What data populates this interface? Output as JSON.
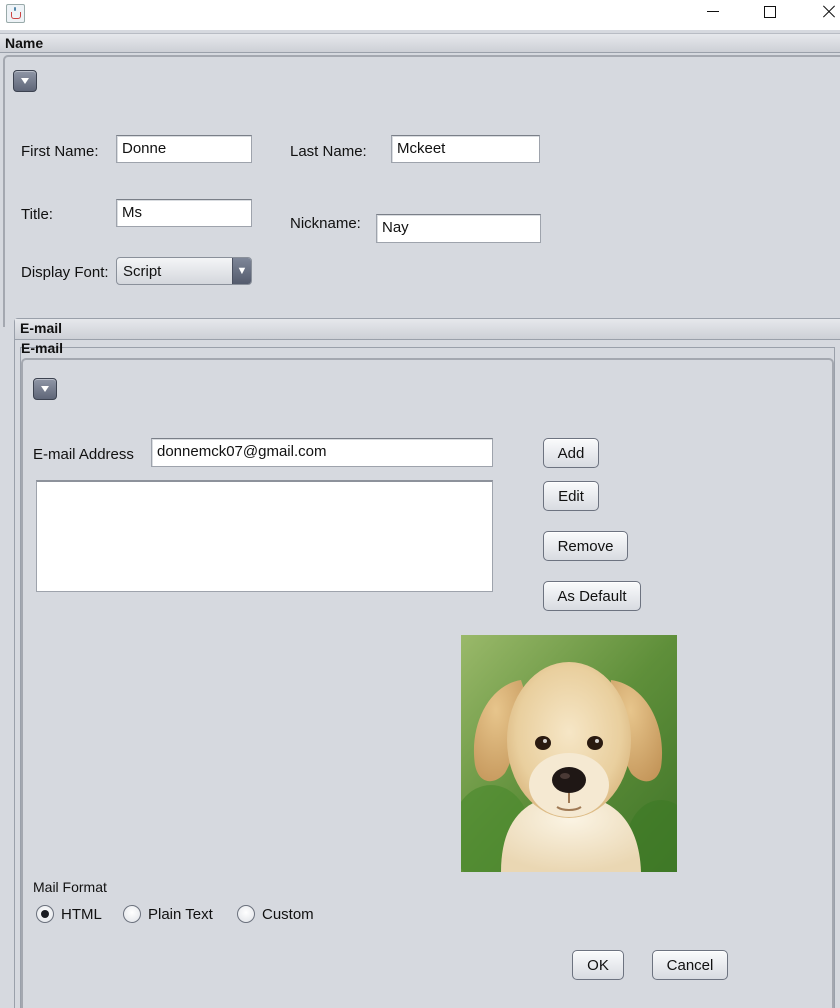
{
  "window": {
    "icon": "java-cup-icon",
    "controls": [
      "minimize-icon",
      "maximize-icon",
      "close-icon"
    ]
  },
  "name_section": {
    "header": "Name",
    "first_name_label": "First Name:",
    "first_name_value": "Donne",
    "last_name_label": "Last Name:",
    "last_name_value": "Mckeet",
    "title_label": "Title:",
    "title_value": "Ms",
    "nickname_label": "Nickname:",
    "nickname_value": "Nay",
    "display_font_label": "Display Font:",
    "display_font_value": "Script"
  },
  "email_section": {
    "outer_header": "E-mail",
    "inner_header": "E-mail",
    "address_label": "E-mail Address",
    "address_value": "donnemck07@gmail.com",
    "emails": [],
    "buttons": {
      "add": "Add",
      "edit": "Edit",
      "remove": "Remove",
      "as_default": "As Default"
    },
    "mail_format_label": "Mail Format",
    "format_options": [
      {
        "label": "HTML",
        "selected": true
      },
      {
        "label": "Plain Text",
        "selected": false
      },
      {
        "label": "Custom",
        "selected": false
      }
    ]
  },
  "dialog_buttons": {
    "ok": "OK",
    "cancel": "Cancel"
  },
  "colors": {
    "background": "#d6d9df",
    "collapse_button": "#6b7284"
  }
}
